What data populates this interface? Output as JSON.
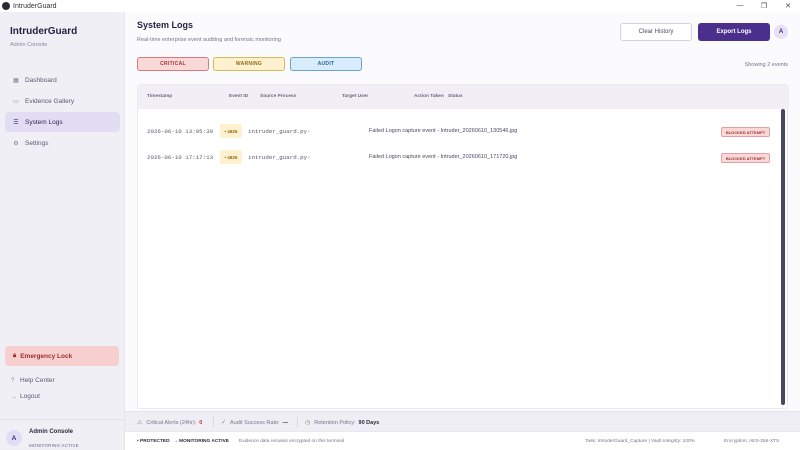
{
  "window": {
    "title": "IntruderGuard",
    "controls": [
      "—",
      "❐",
      "✕"
    ]
  },
  "sidebar": {
    "brand": "IntruderGuard",
    "subtitle": "Admin Console",
    "items": [
      {
        "label": "Dashboard",
        "icon": "grid-icon",
        "glyph": "▦"
      },
      {
        "label": "Evidence Gallery",
        "icon": "image-icon",
        "glyph": "▭"
      },
      {
        "label": "System Logs",
        "icon": "list-icon",
        "glyph": "☰"
      },
      {
        "label": "Settings",
        "icon": "gear-icon",
        "glyph": "⚙"
      }
    ],
    "emergency_label": "Emergency Lock",
    "help_label": "Help Center",
    "logout_label": "Logout",
    "user": {
      "avatar": "A",
      "name": "Admin Console",
      "status": "MONITORING ACTIVE"
    }
  },
  "header": {
    "title": "System Logs",
    "subtitle": "Real-time enterprise event auditing and forensic monitoring",
    "clear_label": "Clear History",
    "export_label": "Export Logs",
    "avatar": "A"
  },
  "filters": {
    "critical": "CRITICAL",
    "warning": "WARNING",
    "audit": "AUDIT"
  },
  "showing": "Showing 2 events",
  "table": {
    "columns": [
      "Timestamp",
      "Event ID",
      "Source Process",
      "Target User",
      "Action Taken",
      "Status"
    ],
    "rows": [
      {
        "timestamp": "2026-06-10  13:05:39",
        "event_id": "• 4625",
        "source": "intruder_guard.py-",
        "target": "",
        "action": "Failed Logon capture event - Intruder_20260610_130546.jpg",
        "status": "BLOCKED ATTEMPT"
      },
      {
        "timestamp": "2026-06-10  17:17:13",
        "event_id": "• 4625",
        "source": "intruder_guard.py-",
        "target": "",
        "action": "Failed Logon capture event - Intruder_20260610_171720.jpg",
        "status": "BLOCKED ATTEMPT"
      }
    ]
  },
  "footer": {
    "critical_label": "Critical Alerts (24hr):",
    "critical_value": "0",
    "success_label": "Audit Success Rate:",
    "success_value": "—",
    "retention_label": "Retention Policy:",
    "retention_value": "90 Days"
  },
  "statusbar": {
    "protected": "• PROTECTED",
    "monitoring": "→ MONITORING ACTIVE",
    "note": "Evidence data remains encrypted on this terminal",
    "task": "Task: IntruderGuard_Capture | Vault Integrity: 100%",
    "encryption": "Encryption: AES-256-XTS"
  },
  "colors": {
    "accent": "#4a2f8c",
    "critical": "#d77a7a",
    "warning": "#d9b85a",
    "audit": "#6aa3d2"
  }
}
